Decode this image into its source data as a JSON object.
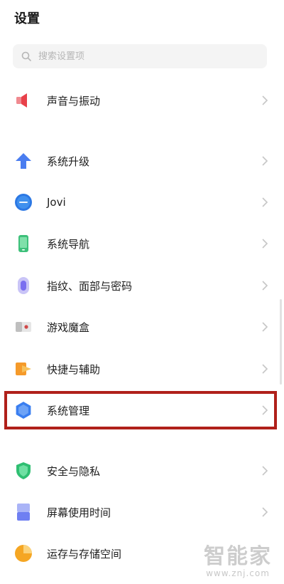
{
  "header": {
    "title": "设置"
  },
  "search": {
    "placeholder": "搜索设置项"
  },
  "settings": [
    {
      "label": "声音与振动",
      "icon": "speaker-icon",
      "color": "#e8414a"
    },
    {
      "label": "系统升级",
      "icon": "arrow-up-icon",
      "color": "#4a7df0"
    },
    {
      "label": "Jovi",
      "icon": "jovi-icon",
      "color": "#2c78e4"
    },
    {
      "label": "系统导航",
      "icon": "phone-icon",
      "color": "#3dc07a"
    },
    {
      "label": "指纹、面部与密码",
      "icon": "fingerprint-icon",
      "color": "#7a6ef0"
    },
    {
      "label": "游戏魔盒",
      "icon": "game-box-icon",
      "color": "#d04848"
    },
    {
      "label": "快捷与辅助",
      "icon": "shortcut-icon",
      "color": "#f59a2a"
    },
    {
      "label": "系统管理",
      "icon": "hexagon-icon",
      "color": "#3a7ef0"
    },
    {
      "label": "安全与隐私",
      "icon": "shield-icon",
      "color": "#2fbf72"
    },
    {
      "label": "屏幕使用时间",
      "icon": "hourglass-icon",
      "color": "#6f7ff2"
    },
    {
      "label": "运存与存储空间",
      "icon": "pie-chart-icon",
      "color": "#f5a623"
    }
  ],
  "watermark": {
    "title": "智能家",
    "url": "www.znj.com"
  }
}
